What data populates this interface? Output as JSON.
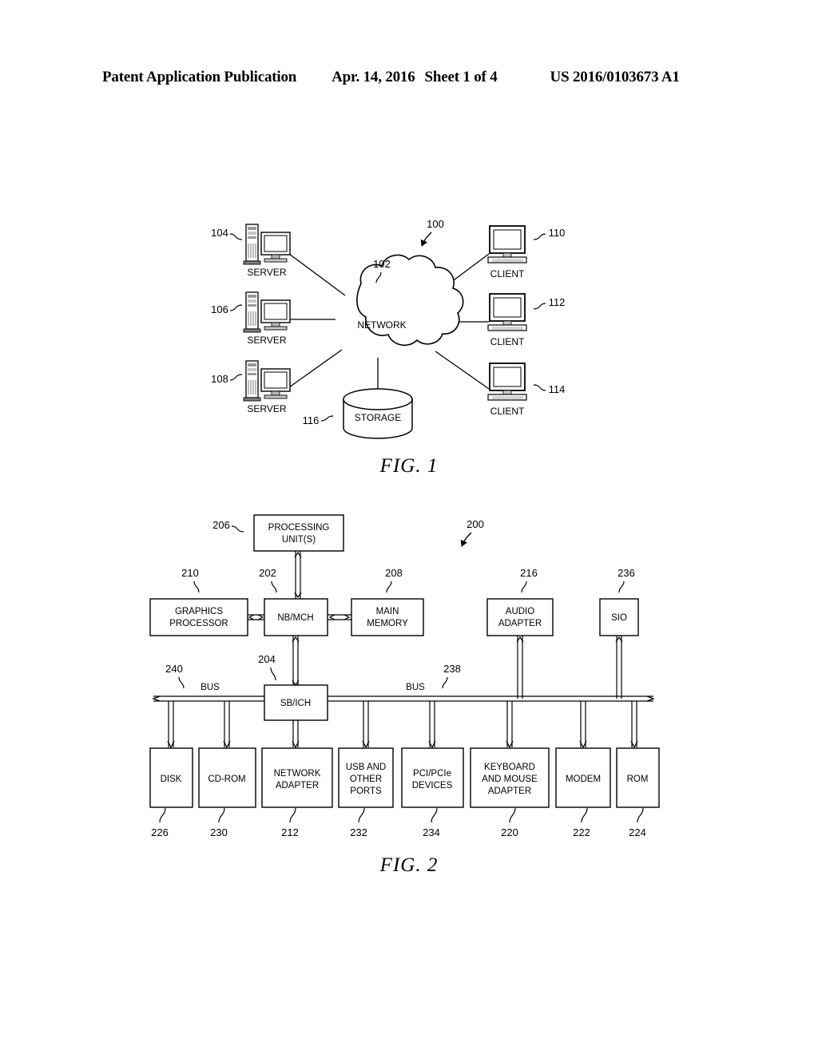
{
  "header": {
    "publication": "Patent Application Publication",
    "date": "Apr. 14, 2016",
    "sheet": "Sheet 1 of 4",
    "number": "US 2016/0103673 A1"
  },
  "figures": [
    {
      "caption": "FIG. 1",
      "system_ref": "100",
      "nodes": {
        "network": {
          "label": "NETWORK",
          "ref": "102",
          "shape": "cloud-icon"
        },
        "storage": {
          "label": "STORAGE",
          "ref": "116",
          "shape": "cylinder-icon"
        },
        "servers": [
          {
            "label": "SERVER",
            "ref": "104"
          },
          {
            "label": "SERVER",
            "ref": "106"
          },
          {
            "label": "SERVER",
            "ref": "108"
          }
        ],
        "clients": [
          {
            "label": "CLIENT",
            "ref": "110"
          },
          {
            "label": "CLIENT",
            "ref": "112"
          },
          {
            "label": "CLIENT",
            "ref": "114"
          }
        ]
      }
    },
    {
      "caption": "FIG. 2",
      "system_ref": "200",
      "bus_labels": [
        {
          "label": "BUS",
          "ref": "240"
        },
        {
          "label": "BUS",
          "ref": "238"
        }
      ],
      "blocks": {
        "processing_unit": {
          "label_line1": "PROCESSING",
          "label_line2": "UNIT(S)",
          "ref": "206"
        },
        "graphics_processor": {
          "label_line1": "GRAPHICS",
          "label_line2": "PROCESSOR",
          "ref": "210"
        },
        "nb_mch": {
          "label_line1": "NB/MCH",
          "ref": "202"
        },
        "main_memory": {
          "label_line1": "MAIN",
          "label_line2": "MEMORY",
          "ref": "208"
        },
        "audio_adapter": {
          "label_line1": "AUDIO",
          "label_line2": "ADAPTER",
          "ref": "216"
        },
        "sio": {
          "label_line1": "SIO",
          "ref": "236"
        },
        "sb_ich": {
          "label_line1": "SB/ICH",
          "ref": "204"
        }
      },
      "devices": [
        {
          "label_line1": "DISK",
          "ref": "226"
        },
        {
          "label_line1": "CD-ROM",
          "ref": "230"
        },
        {
          "label_line1": "NETWORK",
          "label_line2": "ADAPTER",
          "ref": "212"
        },
        {
          "label_line1": "USB AND",
          "label_line2": "OTHER",
          "label_line3": "PORTS",
          "ref": "232"
        },
        {
          "label_line1": "PCI/PCIe",
          "label_line2": "DEVICES",
          "ref": "234"
        },
        {
          "label_line1": "KEYBOARD",
          "label_line2": "AND MOUSE",
          "label_line3": "ADAPTER",
          "ref": "220"
        },
        {
          "label_line1": "MODEM",
          "ref": "222"
        },
        {
          "label_line1": "ROM",
          "ref": "224"
        }
      ]
    }
  ]
}
